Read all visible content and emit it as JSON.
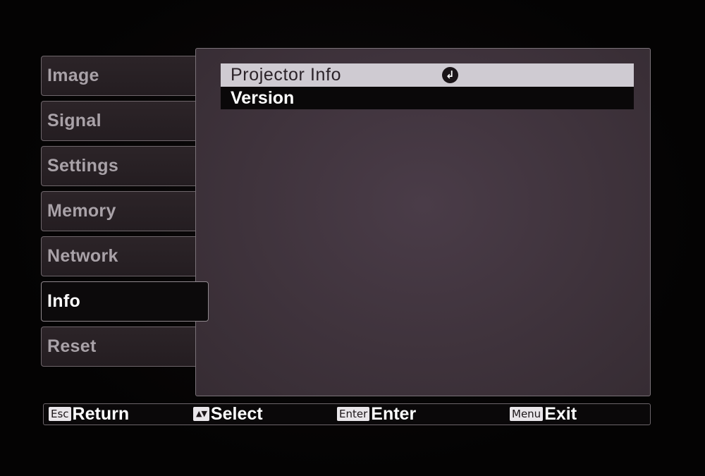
{
  "menu": {
    "tabs": [
      {
        "label": "Image"
      },
      {
        "label": "Signal"
      },
      {
        "label": "Settings"
      },
      {
        "label": "Memory"
      },
      {
        "label": "Network"
      },
      {
        "label": "Info"
      },
      {
        "label": "Reset"
      }
    ],
    "active_tab": "Info"
  },
  "panel": {
    "items": [
      {
        "label": "Projector Info",
        "icon": "enter-return-icon",
        "selected": true
      },
      {
        "label": "Version",
        "selected": false
      }
    ]
  },
  "help_bar": {
    "return": {
      "key": "Esc",
      "label": "Return"
    },
    "select": {
      "key": "▲▼",
      "label": "Select"
    },
    "enter": {
      "key": "Enter",
      "label": "Enter"
    },
    "exit": {
      "key": "Menu",
      "label": "Exit"
    }
  },
  "colors": {
    "panel_background": "#433640",
    "highlight_row": "#cfcbd2",
    "tab_border": "#6e666b"
  }
}
